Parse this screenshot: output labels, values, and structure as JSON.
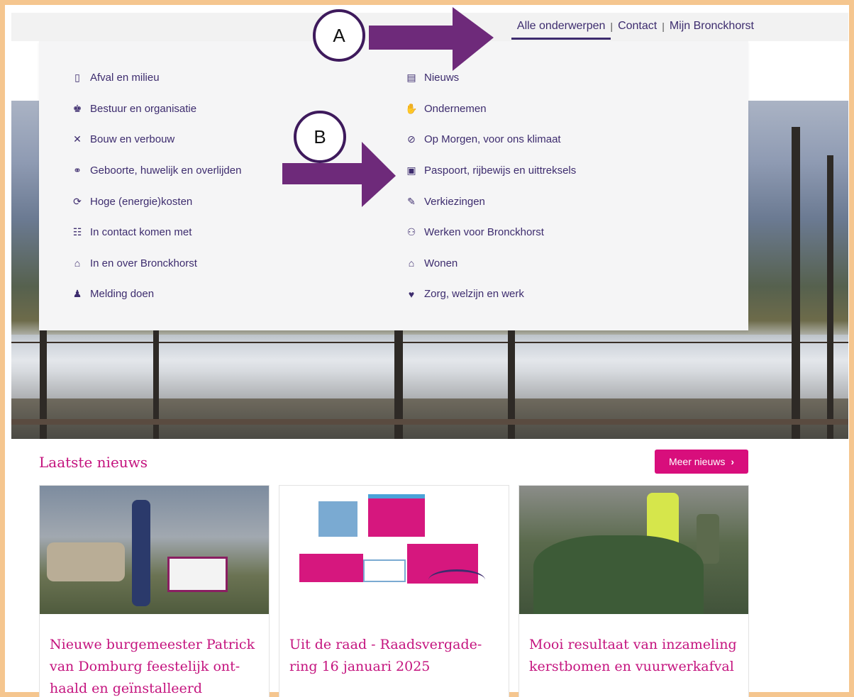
{
  "topnav": {
    "items": [
      {
        "label": "Alle onderwerpen",
        "active": true
      },
      {
        "label": "Contact",
        "active": false
      },
      {
        "label": "Mijn Bronckhorst",
        "active": false
      }
    ],
    "separator": "|"
  },
  "menu": {
    "left": [
      {
        "label": "Afval en milieu",
        "icon": "trash-icon",
        "glyph": "▯"
      },
      {
        "label": "Bestuur en organisatie",
        "icon": "people-icon",
        "glyph": "♚"
      },
      {
        "label": "Bouw en verbouw",
        "icon": "tools-icon",
        "glyph": "✕"
      },
      {
        "label": "Geboorte, huwelijk en overlijden",
        "icon": "rings-icon",
        "glyph": "⚭"
      },
      {
        "label": "Hoge (energie)kosten",
        "icon": "energy-icon",
        "glyph": "⟳"
      },
      {
        "label": "In contact komen met",
        "icon": "contact-icon",
        "glyph": "☷"
      },
      {
        "label": "In en over Bronckhorst",
        "icon": "map-icon",
        "glyph": "⌂"
      },
      {
        "label": "Melding doen",
        "icon": "report-icon",
        "glyph": "♟"
      }
    ],
    "right": [
      {
        "label": "Nieuws",
        "icon": "newspaper-icon",
        "glyph": "▤"
      },
      {
        "label": "Ondernemen",
        "icon": "handshake-icon",
        "glyph": "✋"
      },
      {
        "label": "Op Morgen, voor ons klimaat",
        "icon": "leaf-icon",
        "glyph": "⊘"
      },
      {
        "label": "Paspoort, rijbewijs en uittreksels",
        "icon": "passport-icon",
        "glyph": "▣"
      },
      {
        "label": "Verkiezingen",
        "icon": "pencil-icon",
        "glyph": "✎"
      },
      {
        "label": "Werken voor Bronckhorst",
        "icon": "work-icon",
        "glyph": "⚇"
      },
      {
        "label": "Wonen",
        "icon": "house-icon",
        "glyph": "⌂"
      },
      {
        "label": "Zorg, welzijn en werk",
        "icon": "care-icon",
        "glyph": "♥"
      }
    ]
  },
  "annotations": {
    "a_label": "A",
    "b_label": "B",
    "color": "#6e2a7a"
  },
  "news": {
    "heading": "Laatste nieuws",
    "more_button": "Meer nieuws",
    "cards": [
      {
        "title": "Nieuwe burgemeester Patrick van Domburg feestelijk ont­haald en geïnstalleerd"
      },
      {
        "title": "Uit de raad - Raadsvergade­ring 16 januari 2025"
      },
      {
        "title": "Mooi resultaat van inzame­ling kerstbomen en vuurwerkafval"
      }
    ]
  },
  "colors": {
    "brand_purple": "#3d2c6e",
    "brand_magenta": "#d80e7c",
    "frame": "#f5c68f"
  }
}
